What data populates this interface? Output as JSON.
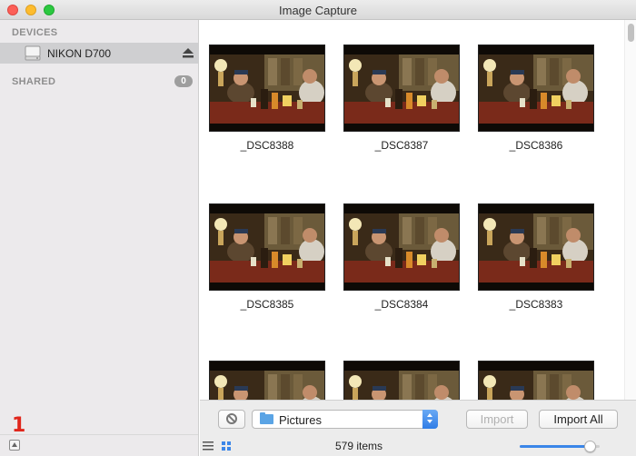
{
  "window": {
    "title": "Image Capture"
  },
  "sidebar": {
    "devices_header": "DEVICES",
    "device": {
      "label": "NIKON D700",
      "icon": "camera-drive-icon"
    },
    "shared_header": "SHARED",
    "shared_count": "0",
    "annotation": "1"
  },
  "photos": [
    {
      "name": "_DSC8388"
    },
    {
      "name": "_DSC8387"
    },
    {
      "name": "_DSC8386"
    },
    {
      "name": "_DSC8385"
    },
    {
      "name": "_DSC8384"
    },
    {
      "name": "_DSC8383"
    },
    {
      "name": ""
    },
    {
      "name": ""
    },
    {
      "name": ""
    }
  ],
  "toolbar": {
    "destination": "Pictures",
    "import_label": "Import",
    "import_all_label": "Import All"
  },
  "status": {
    "items_text": "579 items",
    "zoom_fraction": 0.95
  },
  "colors": {
    "accent": "#3b86e8",
    "sidebar_bg": "#eceaec",
    "selection": "#cfcfd1",
    "annotation": "#e0261c"
  }
}
